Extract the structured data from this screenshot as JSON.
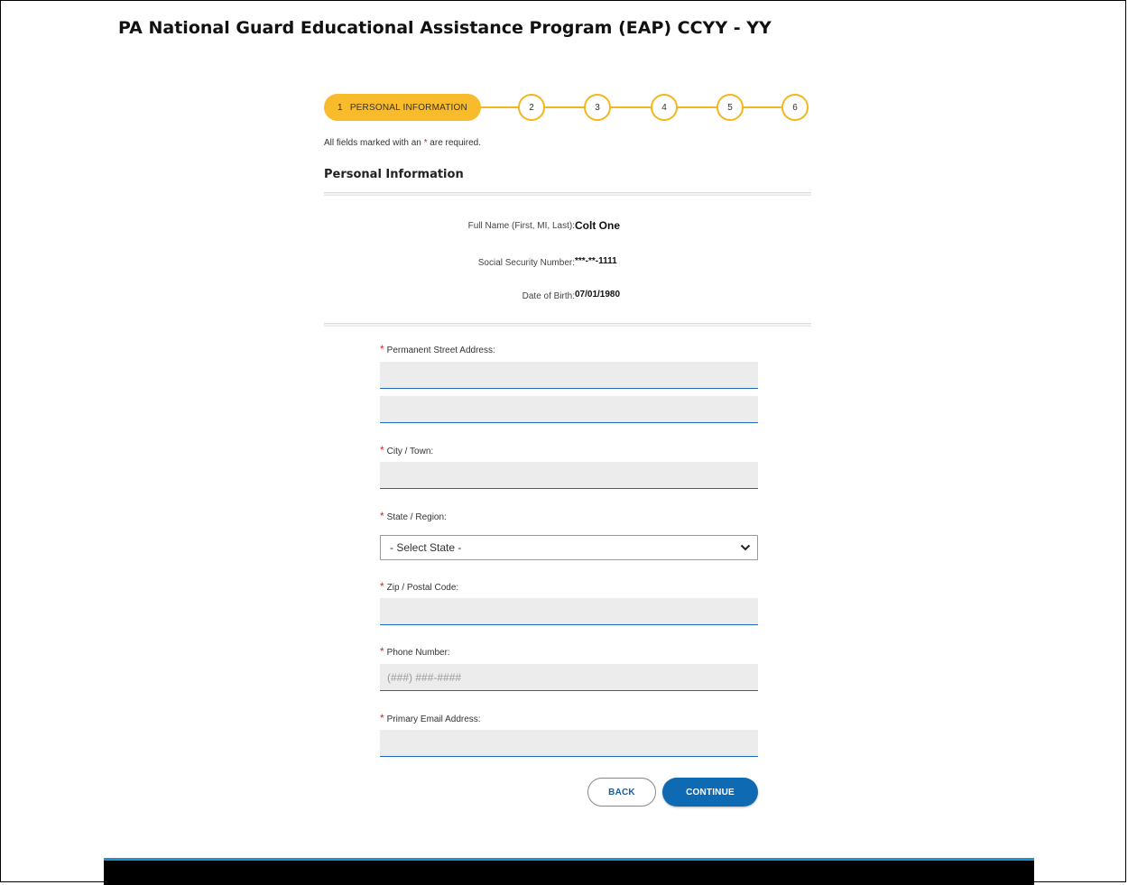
{
  "page": {
    "title": "PA National Guard Educational Assistance Program (EAP) CCYY - YY"
  },
  "stepper": {
    "active_number": "1",
    "active_label": "PERSONAL INFORMATION",
    "steps": [
      "2",
      "3",
      "4",
      "5",
      "6"
    ]
  },
  "required_note": {
    "prefix": "All fields marked with an",
    "star": "*",
    "suffix": "are required."
  },
  "section": {
    "title": "Personal Information"
  },
  "personal_info": {
    "full_name_label": "Full Name (First, MI, Last):",
    "full_name_value": "Colt One",
    "ssn_label": "Social Security Number:",
    "ssn_value": "***-**-1111",
    "dob_label": "Date of Birth:",
    "dob_value": "07/01/1980"
  },
  "form": {
    "required_mark": "*",
    "street_label": "Permanent Street Address:",
    "street_line1_value": "",
    "street_line2_value": "",
    "city_label": "City / Town:",
    "city_value": "",
    "state_label": "State / Region:",
    "state_selected": "- Select State -",
    "zip_label": "Zip / Postal Code:",
    "zip_value": "",
    "phone_label": "Phone Number:",
    "phone_placeholder": "(###) ###-####",
    "email_label": "Primary Email Address:",
    "email_value": ""
  },
  "buttons": {
    "back": "BACK",
    "continue": "CONTINUE"
  },
  "colors": {
    "step_accent": "#f7bb2b",
    "required_star": "#dd2222",
    "input_underline": "#1d6bb3",
    "primary_button": "#0f6ab4",
    "footer_bar": "#000000",
    "footer_accent": "#1f8fd0"
  },
  "icons": {
    "select_arrow": "chevron-down-icon"
  }
}
